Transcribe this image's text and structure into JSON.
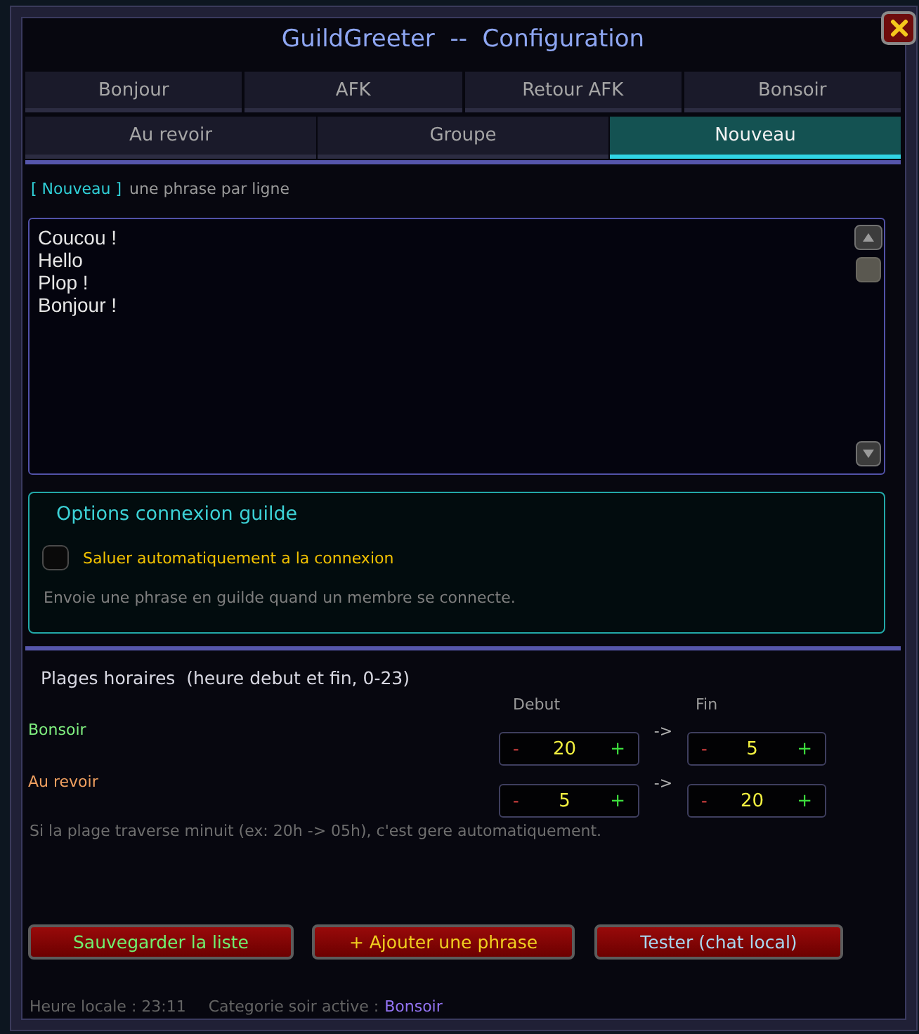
{
  "window": {
    "title": "GuildGreeter  --  Configuration"
  },
  "tab_rows": [
    {
      "tabs": [
        {
          "label": "Bonjour",
          "selected": false
        },
        {
          "label": "AFK",
          "selected": false
        },
        {
          "label": "Retour AFK",
          "selected": false
        },
        {
          "label": "Bonsoir",
          "selected": false
        }
      ]
    },
    {
      "tabs": [
        {
          "label": "Au revoir",
          "selected": false
        },
        {
          "label": "Groupe",
          "selected": false
        },
        {
          "label": "Nouveau",
          "selected": true
        }
      ]
    }
  ],
  "editor": {
    "tag": "[ Nouveau ]",
    "hint": "une phrase par ligne",
    "lines": [
      "Coucou !",
      "Hello",
      "Plop !",
      "Bonjour !"
    ]
  },
  "options": {
    "title": "Options connexion guilde",
    "checkbox": {
      "label": "Saluer automatiquement a la connexion",
      "checked": false
    },
    "description": "Envoie une phrase en guilde quand un membre se connecte."
  },
  "schedule": {
    "title": "Plages horaires  (heure debut et fin, 0-23)",
    "columns": [
      "Debut",
      "Fin"
    ],
    "rows": [
      {
        "label": "Bonsoir",
        "color": "#80f080",
        "start": {
          "dec": "-",
          "value": "20",
          "inc": "+"
        },
        "separator": "->",
        "end": {
          "dec": "-",
          "value": "5",
          "inc": "+"
        }
      },
      {
        "label": "Au revoir",
        "color": "#f0a060",
        "start": {
          "dec": "-",
          "value": "5",
          "inc": "+"
        },
        "separator": "->",
        "end": {
          "dec": "-",
          "value": "20",
          "inc": "+"
        }
      }
    ],
    "note": "Si la plage traverse minuit (ex: 20h -> 05h), c'est gere automatiquement."
  },
  "buttons": [
    {
      "label": "Sauvegarder la liste",
      "kind": "save"
    },
    {
      "label": "+ Ajouter une phrase",
      "kind": "add"
    },
    {
      "label": "Tester (chat local)",
      "kind": "test"
    }
  ],
  "status": {
    "local_time": "Heure locale : 23:11",
    "active_label": "Categorie soir active :",
    "active_value": "Bonsoir"
  }
}
